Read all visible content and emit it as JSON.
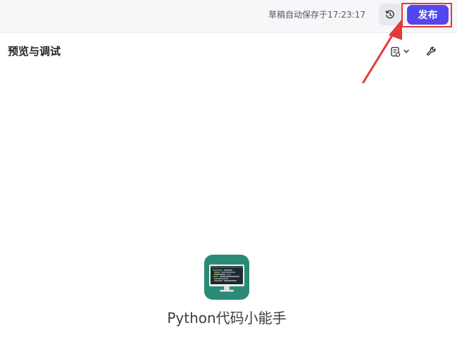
{
  "topbar": {
    "save_status": "草稿自动保存于17:23:17",
    "history_icon": "history-icon",
    "publish_label": "发布"
  },
  "panel": {
    "title": "预览与调试",
    "debug_menu_icon": "document-list-icon",
    "dropdown_icon": "chevron-down-icon",
    "settings_icon": "wrench-icon"
  },
  "bot": {
    "name": "Python代码小能手",
    "avatar_icon": "monitor-code-icon"
  },
  "colors": {
    "accent": "#5247ee",
    "annotation": "#e53935",
    "avatar_bg": "#2b8a76"
  }
}
